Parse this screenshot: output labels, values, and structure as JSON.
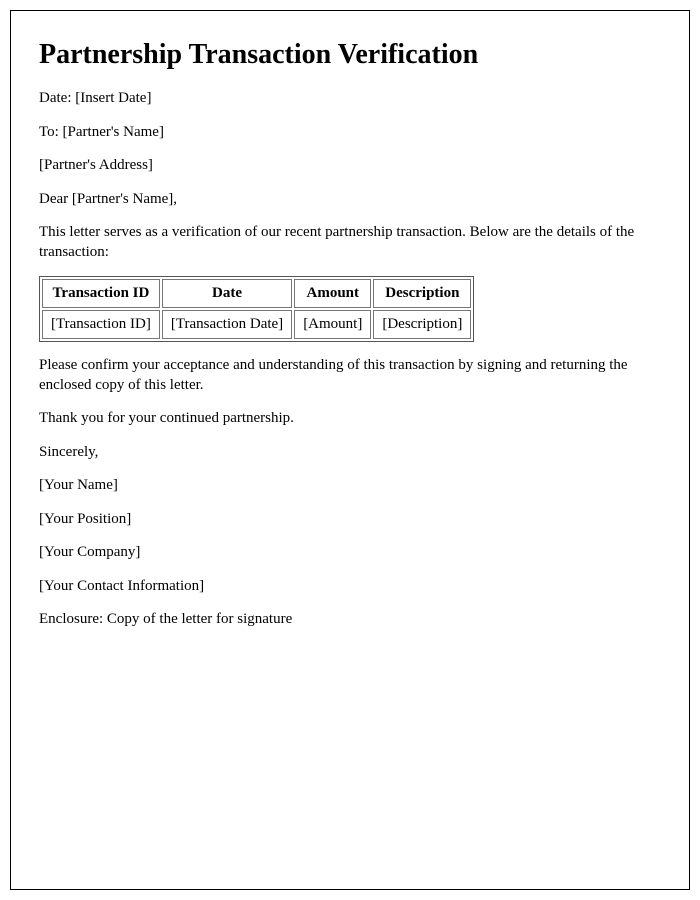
{
  "title": "Partnership Transaction Verification",
  "date_line": "Date: [Insert Date]",
  "to_line": "To: [Partner's Name]",
  "address_line": "[Partner's Address]",
  "salutation": "Dear [Partner's Name],",
  "intro": "This letter serves as a verification of our recent partnership transaction. Below are the details of the transaction:",
  "table": {
    "headers": {
      "id": "Transaction ID",
      "date": "Date",
      "amount": "Amount",
      "description": "Description"
    },
    "row": {
      "id": "[Transaction ID]",
      "date": "[Transaction Date]",
      "amount": "[Amount]",
      "description": "[Description]"
    }
  },
  "confirm": "Please confirm your acceptance and understanding of this transaction by signing and returning the enclosed copy of this letter.",
  "thanks": "Thank you for your continued partnership.",
  "closing": "Sincerely,",
  "your_name": "[Your Name]",
  "your_position": "[Your Position]",
  "your_company": "[Your Company]",
  "your_contact": "[Your Contact Information]",
  "enclosure": "Enclosure: Copy of the letter for signature"
}
